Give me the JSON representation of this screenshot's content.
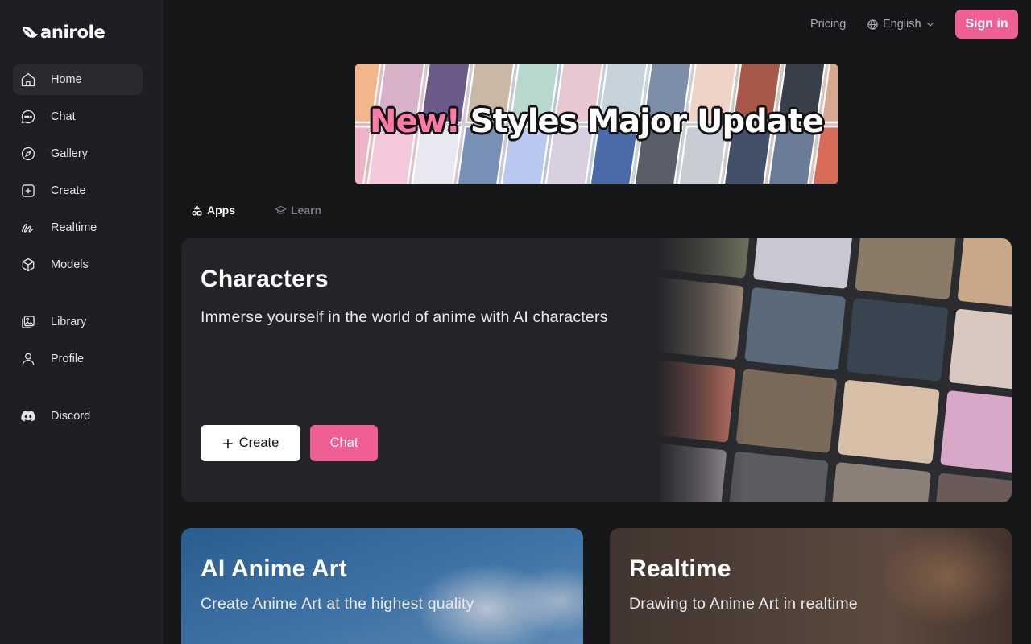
{
  "brand": {
    "name": "anirole"
  },
  "sidebar": {
    "items": [
      {
        "label": "Home",
        "icon": "home-icon",
        "active": true
      },
      {
        "label": "Chat",
        "icon": "chat-bubble-icon"
      },
      {
        "label": "Gallery",
        "icon": "compass-icon"
      },
      {
        "label": "Create",
        "icon": "plus-square-icon"
      },
      {
        "label": "Realtime",
        "icon": "scribble-icon"
      },
      {
        "label": "Models",
        "icon": "cube-icon"
      }
    ],
    "secondary": [
      {
        "label": "Library",
        "icon": "image-stack-icon"
      },
      {
        "label": "Profile",
        "icon": "user-icon"
      }
    ],
    "community": [
      {
        "label": "Discord",
        "icon": "discord-icon"
      }
    ]
  },
  "topbar": {
    "pricing": "Pricing",
    "language": "English",
    "signin": "Sign in"
  },
  "banner": {
    "highlight": "New!",
    "text": "Styles Major Update"
  },
  "tabs": [
    {
      "label": "Apps",
      "icon": "shapes-icon",
      "active": true
    },
    {
      "label": "Learn",
      "icon": "graduation-cap-icon",
      "active": false
    }
  ],
  "cards": {
    "characters": {
      "title": "Characters",
      "description": "Immerse yourself in the world of anime with AI characters",
      "create_label": "Create",
      "chat_label": "Chat"
    },
    "ai_anime_art": {
      "title": "AI Anime Art",
      "description": "Create Anime Art at the highest quality"
    },
    "realtime": {
      "title": "Realtime",
      "description": "Drawing to Anime Art in realtime"
    }
  },
  "colors": {
    "accent": "#ef5f96",
    "background": "#161719",
    "sidebar": "#1e1f22",
    "card": "#232428"
  }
}
